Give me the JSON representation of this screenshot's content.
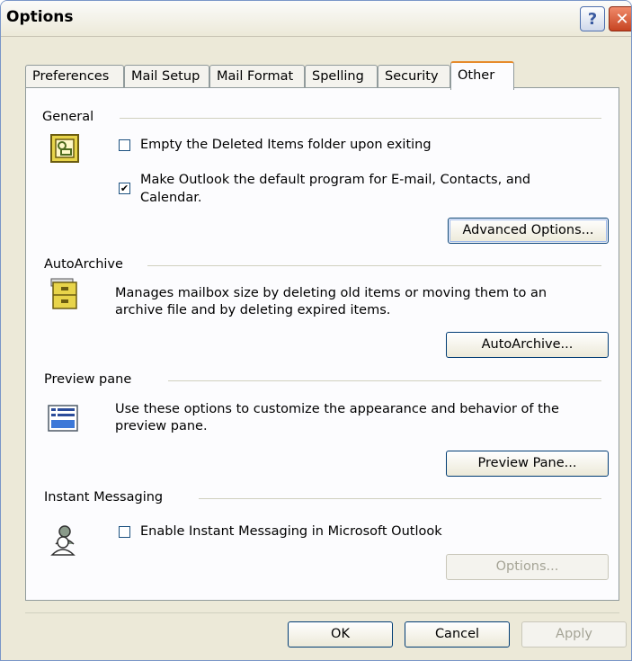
{
  "window": {
    "title": "Options",
    "help_glyph": "?",
    "close_glyph": "✕"
  },
  "tabs": [
    {
      "label": "Preferences"
    },
    {
      "label": "Mail Setup"
    },
    {
      "label": "Mail Format"
    },
    {
      "label": "Spelling"
    },
    {
      "label": "Security"
    },
    {
      "label": "Other",
      "active": true
    }
  ],
  "general": {
    "heading": "General",
    "empty_deleted_label": "Empty the Deleted Items folder upon exiting",
    "empty_deleted_checked": false,
    "default_program_label_line1": "Make Outlook the default program for E-mail, Contacts, and",
    "default_program_label_line2": "Calendar.",
    "default_program_checked": true,
    "advanced_button": "Advanced Options..."
  },
  "autoarchive": {
    "heading": "AutoArchive",
    "description_line1": "Manages mailbox size by deleting old items or moving them to an",
    "description_line2": "archive file and by deleting expired items.",
    "button": "AutoArchive..."
  },
  "preview_pane": {
    "heading": "Preview pane",
    "description_line1": "Use these options to customize the appearance and behavior of the",
    "description_line2": "preview pane.",
    "button": "Preview Pane..."
  },
  "instant_messaging": {
    "heading": "Instant Messaging",
    "enable_label": "Enable Instant Messaging in Microsoft Outlook",
    "enable_checked": false,
    "options_button": "Options..."
  },
  "footer": {
    "ok": "OK",
    "cancel": "Cancel",
    "apply": "Apply"
  },
  "check_glyph": "✔",
  "colors": {
    "tab_highlight": "#e68b2c",
    "panel_bg": "#fcfcfe",
    "dialog_bg": "#ece9d8",
    "button_border": "#003c74"
  }
}
